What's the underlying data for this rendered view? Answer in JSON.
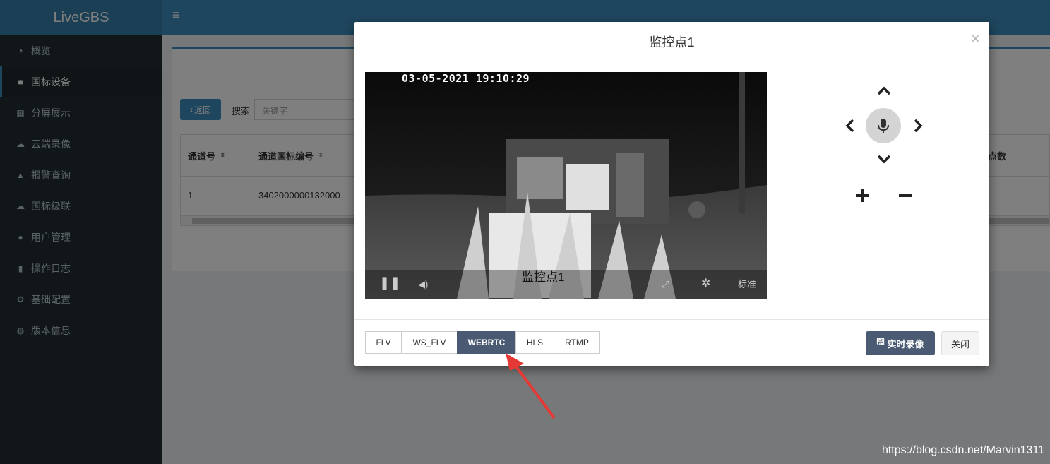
{
  "app": {
    "name": "LiveGBS"
  },
  "sidebar": {
    "items": [
      {
        "icon": "dashboard-icon",
        "label": "概览"
      },
      {
        "icon": "video-camera-icon",
        "label": "国标设备"
      },
      {
        "icon": "grid-icon",
        "label": "分屏展示"
      },
      {
        "icon": "cloud-icon",
        "label": "云端录像"
      },
      {
        "icon": "bell-icon",
        "label": "报警查询"
      },
      {
        "icon": "cloud-upload-icon",
        "label": "国标级联"
      },
      {
        "icon": "users-icon",
        "label": "用户管理"
      },
      {
        "icon": "file-icon",
        "label": "操作日志"
      },
      {
        "icon": "gears-icon",
        "label": "基础配置"
      },
      {
        "icon": "globe-icon",
        "label": "版本信息"
      }
    ]
  },
  "toolbar": {
    "back_label": "返回",
    "search_label": "搜索",
    "search_placeholder": "关键字"
  },
  "table": {
    "headers": [
      "通道号",
      "通道国标编号",
      "节点数"
    ],
    "rows": [
      [
        "1",
        "3402000000132000"
      ]
    ]
  },
  "modal": {
    "title": "监控点1",
    "video": {
      "timestamp": "03-05-2021 19:10:29",
      "title": "监控点1",
      "quality_label": "标准"
    },
    "protocols": [
      {
        "label": "FLV",
        "active": false
      },
      {
        "label": "WS_FLV",
        "active": false
      },
      {
        "label": "WEBRTC",
        "active": true
      },
      {
        "label": "HLS",
        "active": false
      },
      {
        "label": "RTMP",
        "active": false
      }
    ],
    "record_label": "实时录像",
    "close_label": "关闭"
  },
  "watermark": "https://blog.csdn.net/Marvin1311",
  "colors": {
    "accent": "#3c8dbc",
    "sidebar_bg": "#222d32",
    "active_proto": "#4a5a73",
    "arrow": "#e53935"
  }
}
